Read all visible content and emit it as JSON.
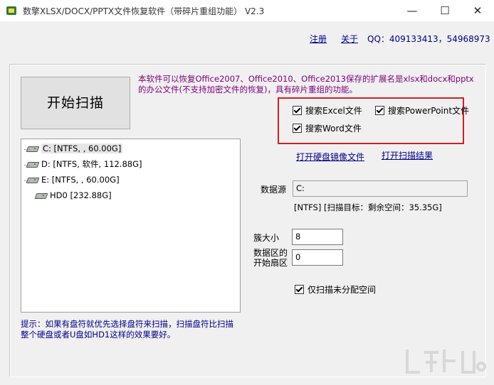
{
  "window": {
    "title": "数擎XLSX/DOCX/PPTX文件恢复软件（带碎片重组功能） V2.3",
    "minimize_glyph": "—",
    "maximize_glyph": "☐",
    "close_glyph": "✕"
  },
  "header": {
    "register_label": "注册",
    "about_label": "关于",
    "qq_text": "QQ：409133413，54968973"
  },
  "main": {
    "start_button_label": "开始扫描",
    "description": "本软件可以恢复Office2007、Office2010、Office2013保存的扩展名是xlsx和docx和pptx的办公文件(不支持加密文件的恢复)，具有碎片重组的功能。",
    "checkboxes": {
      "excel": {
        "label": "搜索Excel文件",
        "checked": true
      },
      "powerpoint": {
        "label": "搜索PowerPoint文件",
        "checked": true
      },
      "word": {
        "label": "搜索Word文件",
        "checked": true
      }
    },
    "open_image_link": "打开硬盘镜像文件",
    "open_result_link": "打开扫描结果",
    "drives": [
      {
        "label": "C:  [NTFS, , 60.00G]",
        "selected": true
      },
      {
        "label": "D:  [NTFS, 软件, 112.88G]",
        "selected": false
      },
      {
        "label": "E:  [NTFS, , 60.00G]",
        "selected": false
      },
      {
        "label": "HD0   [232.88G]",
        "selected": false
      }
    ],
    "hint": "提示：如果有盘符就优先选择盘符来扫描，扫描盘符比扫描整个硬盘或者U盘如HD1这样的效果要好。",
    "data_source_label": "数据源",
    "data_source_value": "C:",
    "status_line": "[NTFS] [扫描目标：剩余空间：35.35G]",
    "cluster_size_label": "簇大小",
    "cluster_size_value": "8",
    "data_start_sector_label_1": "数据区的",
    "data_start_sector_label_2": "开始扇区",
    "data_start_sector_value": "0",
    "only_unallocated": {
      "label": "仅扫描未分配空间",
      "checked": true
    }
  },
  "colors": {
    "link": "#00008b",
    "description": "#800080",
    "highlight": "#d12020"
  }
}
